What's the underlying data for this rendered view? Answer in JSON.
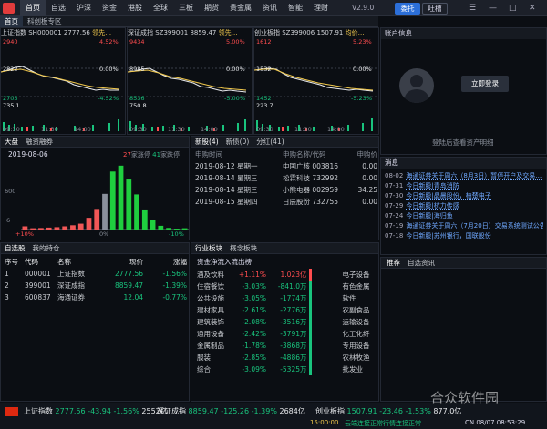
{
  "topbar": {
    "menu": [
      "首页",
      "自选",
      "沪深",
      "资金",
      "港股",
      "全球",
      "三板",
      "期货",
      "贵金属",
      "资讯",
      "智能",
      "理财"
    ],
    "version": "V2.9.0",
    "entrust": "委托",
    "tucao": "吐槽",
    "window_controls": [
      "☰",
      "—",
      "□",
      "✕"
    ]
  },
  "subtabs": [
    "首页",
    "科创板专区"
  ],
  "indices": [
    {
      "name": "上证指数",
      "code": "SH000001",
      "price": "2777.56",
      "tag": "领先…",
      "hi": "2940",
      "hi_pct": "4.52%",
      "mid": "2822",
      "mid_pct": "0.00%",
      "lo": "2703",
      "lo_pct": "-4.52%",
      "lo2": "735.1",
      "t0": "09:30",
      "t1": "11:30",
      "t2": "14:00"
    },
    {
      "name": "深证成指",
      "code": "SZ399001",
      "price": "8859.47",
      "tag": "领先…",
      "hi": "9434",
      "hi_pct": "5.00%",
      "mid": "8985",
      "mid_pct": "0.00%",
      "lo": "8536",
      "lo_pct": "-5.00%",
      "lo2": "750.8",
      "t0": "09:30",
      "t1": "11:30",
      "t2": "14:00"
    },
    {
      "name": "创业板指",
      "code": "SZ399006",
      "price": "1507.91",
      "tag": "均价…",
      "hi": "1612",
      "hi_pct": "5.23%",
      "mid": "1532",
      "mid_pct": "0.00%",
      "lo": "1452",
      "lo_pct": "-5.23%",
      "lo2": "223.7",
      "t0": "09:30",
      "t1": "11:30",
      "t2": "14:00"
    }
  ],
  "dapan": {
    "tabs": [
      "大盘",
      "融资融券"
    ],
    "date": "2019-08-06",
    "up_count": "27",
    "up_label": "家涨停",
    "down_count": "41",
    "down_label": "家跌停",
    "y_top": "600",
    "y_mid": "6",
    "x_left": "+10%",
    "x_mid": "0%",
    "x_right": "-10%"
  },
  "chart_data": {
    "type": "bar",
    "title": "",
    "categories": [
      "+10%",
      "",
      "",
      "",
      "",
      "",
      "",
      "",
      "",
      "",
      "0%",
      "",
      "",
      "",
      "",
      "",
      "",
      "",
      "",
      "",
      "-10%"
    ],
    "values": [
      30,
      12,
      14,
      18,
      22,
      30,
      40,
      55,
      110,
      185,
      335,
      545,
      600,
      470,
      330,
      180,
      90,
      35,
      15,
      8,
      12
    ],
    "colors_note": "left half red (up), right half green (down)",
    "ylim": [
      0,
      650
    ]
  },
  "ipo": {
    "tabs": [
      "新股(4)",
      "新债(0)",
      "分红(41)"
    ],
    "headers": [
      "申购时间",
      "申购名称/代码",
      "申购价"
    ],
    "rows": [
      {
        "date": "2019-08-12",
        "weekday": "星期一",
        "name": "中国广核",
        "code": "003816",
        "price": "0.00"
      },
      {
        "date": "2019-08-14",
        "weekday": "星期三",
        "name": "松霖科技",
        "code": "732992",
        "price": "0.00"
      },
      {
        "date": "2019-08-14",
        "weekday": "星期三",
        "name": "小熊电器",
        "code": "002959",
        "price": "34.25"
      },
      {
        "date": "2019-08-15",
        "weekday": "星期四",
        "name": "日辰股份",
        "code": "732755",
        "price": "0.00"
      }
    ]
  },
  "watch": {
    "tabs": [
      "自选股",
      "我的持仓"
    ],
    "headers": [
      "序号",
      "代码",
      "名称",
      "现价",
      "涨幅"
    ],
    "rows": [
      {
        "no": "1",
        "code": "000001",
        "name": "上证指数",
        "price": "2777.56",
        "pct": "-1.56%"
      },
      {
        "no": "2",
        "code": "399001",
        "name": "深证成指",
        "price": "8859.47",
        "pct": "-1.39%"
      },
      {
        "no": "3",
        "code": "600837",
        "name": "海通证券",
        "price": "12.04",
        "pct": "-0.77%"
      }
    ]
  },
  "sectors": {
    "tabs": [
      "行业板块",
      "概念板块"
    ],
    "subtitle": "资金净流入流出榜",
    "rows": [
      {
        "name": "酒及饮料",
        "pct": "+1.11%",
        "flow": "1.023亿",
        "peer": "电子设备"
      },
      {
        "name": "住宿餐饮",
        "pct": "-3.03%",
        "flow": "-841.0万",
        "peer": "有色金属"
      },
      {
        "name": "公共设施",
        "pct": "-3.05%",
        "flow": "-1774万",
        "peer": "软件"
      },
      {
        "name": "建材家具",
        "pct": "-2.61%",
        "flow": "-2776万",
        "peer": "农副食品"
      },
      {
        "name": "建筑装饰",
        "pct": "-2.08%",
        "flow": "-3516万",
        "peer": "运输设备"
      },
      {
        "name": "通用设备",
        "pct": "-2.42%",
        "flow": "-3791万",
        "peer": "化工化纤"
      },
      {
        "name": "金属制品",
        "pct": "-1.78%",
        "flow": "-3868万",
        "peer": "专用设备"
      },
      {
        "name": "服装",
        "pct": "-2.85%",
        "flow": "-4886万",
        "peer": "农林牧渔"
      },
      {
        "name": "综合",
        "pct": "-3.09%",
        "flow": "-5325万",
        "peer": "批发业"
      }
    ]
  },
  "account": {
    "title": "账户信息",
    "login": "立即登录",
    "hint": "登陆后查看资产明细"
  },
  "messages": {
    "title": "消息",
    "rows": [
      {
        "date": "08-02",
        "text": "海通证券关于周六（8月3日）暂停开户及交易…"
      },
      {
        "date": "07-31",
        "text": "今日新股|青岛消防"
      },
      {
        "date": "07-30",
        "text": "今日新股|晶晨股份，柏楚电子"
      },
      {
        "date": "07-29",
        "text": "今日新股|杭力传感"
      },
      {
        "date": "07-24",
        "text": "今日新股|海归鱼"
      },
      {
        "date": "07-19",
        "text": "海通证券关于周六（7月20日）交易系统测试公告"
      },
      {
        "date": "07-18",
        "text": "今日新股|苏州银行，国联股份"
      }
    ]
  },
  "news": {
    "tabs": [
      "推荐",
      "自选资讯"
    ]
  },
  "statusbar": {
    "tickers": [
      {
        "name": "上证指数",
        "price": "2777.56",
        "chg": "-43.94",
        "pct": "-1.56%",
        "vol": "2552亿"
      },
      {
        "name": "深证成指",
        "price": "8859.47",
        "chg": "-125.26",
        "pct": "-1.39%",
        "vol": "2684亿"
      },
      {
        "name": "创业板指",
        "price": "1507.91",
        "chg": "-23.46",
        "pct": "-1.53%",
        "vol": "877.0亿"
      }
    ],
    "time1": "15:00:00",
    "status1": "云端连接正常",
    "status2": "行情连接正常",
    "clock": "CN 08/07 08:53:29",
    "watermark": "合众软件园"
  }
}
